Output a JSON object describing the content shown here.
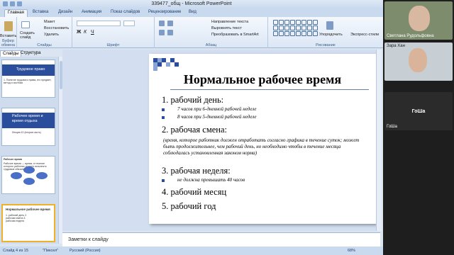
{
  "window": {
    "title": "339477_общ - Microsoft PowerPoint"
  },
  "tabs": [
    "Главная",
    "Вставка",
    "Дизайн",
    "Анимация",
    "Показ слайдов",
    "Рецензирование",
    "Вид"
  ],
  "ribbon": {
    "paste": "Вставить",
    "create_slide": "Создать слайд",
    "layout": "Макет",
    "reset": "Восстановить",
    "delete": "Удалить",
    "groups": {
      "clipboard": "Буфер обмена",
      "slides": "Слайды",
      "font": "Шрифт",
      "paragraph": "Абзац",
      "drawing": "Рисование"
    },
    "text_direction": "Направление текста",
    "align_text": "Выровнять текст",
    "smartart": "Преобразовать в SmartArt",
    "arrange": "Упорядочить",
    "quick_styles": "Экспресс-стили"
  },
  "panes": {
    "tab_slides": "Слайды",
    "tab_outline": "Структура"
  },
  "thumbnails": [
    {
      "title": "Трудовое право",
      "text": "1. Понятие трудового права, его предмет, метод и система"
    },
    {
      "title": "Рабочее время и время отдыха",
      "text": "Лекция 10 (вторая часть)"
    },
    {
      "title": "Рабочее время",
      "text": "Рабочее время — время, в течение которого работник должен исполнять трудовые обязанности"
    },
    {
      "title": "Нормальное рабочее время",
      "text": "1. рабочий день 2. рабочая смена 3. рабочая неделя"
    }
  ],
  "slide": {
    "title": "Нормальное рабочее время",
    "items": [
      {
        "heading": "1. рабочий день:",
        "subs": [
          "7 часов при 6-дневной рабочей неделе",
          "8 часов при 5-дневной рабочей неделе"
        ]
      },
      {
        "heading": "2. рабочая смена:",
        "para": "(время, которое работник должен отработать согласно графика в течение суток; может быть продолжительнее, чем рабочий день, но необходимо чтобы в течение месяца соблюдалась установленная законом норма)"
      },
      {
        "heading": "3. рабочая неделя:",
        "subs": [
          "не должна превышать 40 часов"
        ]
      },
      {
        "heading": "4. рабочий месяц"
      },
      {
        "heading": "5. рабочий год"
      }
    ]
  },
  "notes": {
    "placeholder": "Заметки к слайду"
  },
  "status": {
    "slide": "Слайд 4 из 15",
    "theme": "\"Пиксел\"",
    "language": "Русский (Россия)",
    "zoom": "68%"
  },
  "video": {
    "participants": [
      {
        "name": "Светлана Рудольфовна"
      },
      {
        "name": "Зара Хан"
      },
      {
        "name": "ГоШа",
        "label": "ГоШа"
      }
    ]
  }
}
